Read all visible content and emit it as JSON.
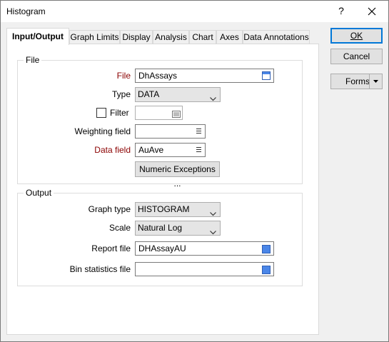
{
  "window": {
    "title": "Histogram",
    "help": "?"
  },
  "tabs": [
    {
      "label": "Input/Output"
    },
    {
      "label": "Graph Limits"
    },
    {
      "label": "Display"
    },
    {
      "label": "Analysis"
    },
    {
      "label": "Chart"
    },
    {
      "label": "Axes"
    },
    {
      "label": "Data Annotations"
    }
  ],
  "file_group": {
    "title": "File",
    "file_label": "File",
    "file_value": "DhAssays",
    "type_label": "Type",
    "type_value": "DATA",
    "filter_label": "Filter",
    "filter_value": "",
    "weighting_label": "Weighting field",
    "weighting_value": "",
    "datafield_label": "Data field",
    "datafield_value": "AuAve",
    "numeric_exceptions": "Numeric Exceptions ..."
  },
  "output_group": {
    "title": "Output",
    "graphtype_label": "Graph type",
    "graphtype_value": "HISTOGRAM",
    "scale_label": "Scale",
    "scale_value": "Natural Log",
    "report_label": "Report file",
    "report_value": "DHAssayAU",
    "binstats_label": "Bin statistics file",
    "binstats_value": ""
  },
  "buttons": {
    "ok": "OK",
    "cancel": "Cancel",
    "forms": "Forms"
  },
  "colors": {
    "required_label": "#8b0000",
    "file_icon": "#4a86e8",
    "default_button_border": "#0078d7"
  }
}
